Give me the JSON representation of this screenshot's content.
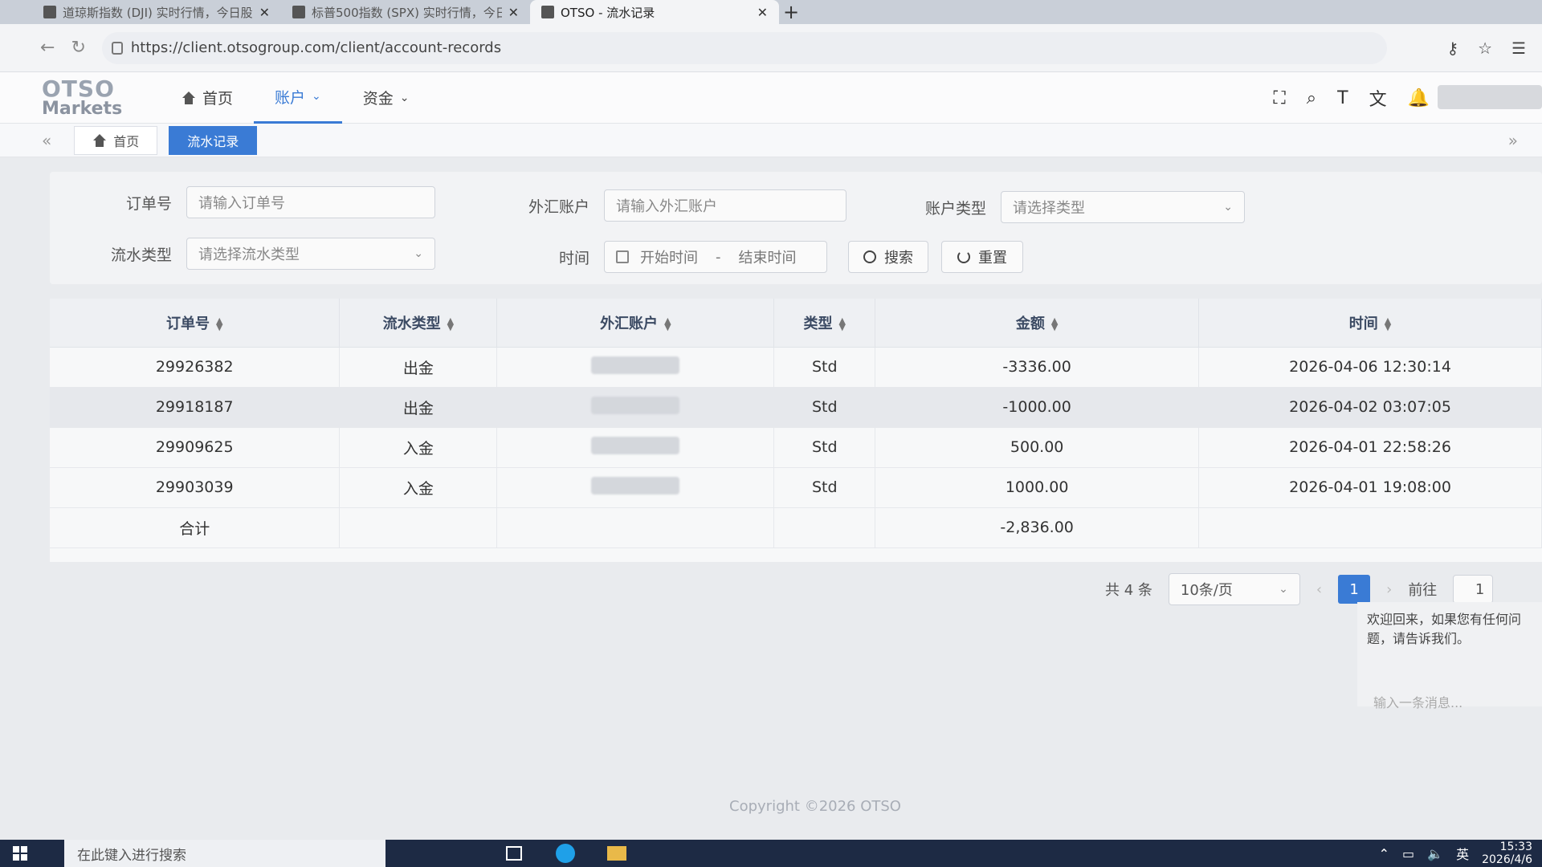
{
  "browser": {
    "tabs": [
      {
        "title": "道琼斯指数 (DJI) 实时行情，今日股",
        "active": false
      },
      {
        "title": "标普500指数 (SPX) 实时行情，今日",
        "active": false
      },
      {
        "title": "OTSO - 流水记录",
        "active": true
      }
    ],
    "new_tab": "+",
    "url": "https://client.otsogroup.com/client/account-records"
  },
  "app": {
    "logo_line1": "OTSO",
    "logo_line2": "Markets",
    "nav": [
      {
        "label": "首页",
        "active": false
      },
      {
        "label": "账户",
        "active": true
      },
      {
        "label": "资金",
        "active": false
      }
    ]
  },
  "tags": [
    {
      "label": "首页",
      "active": false
    },
    {
      "label": "流水记录",
      "active": true
    }
  ],
  "filters": {
    "order_no_label": "订单号",
    "order_no_placeholder": "请输入订单号",
    "fx_account_label": "外汇账户",
    "fx_account_placeholder": "请输入外汇账户",
    "account_type_label": "账户类型",
    "account_type_placeholder": "请选择类型",
    "flow_type_label": "流水类型",
    "flow_type_placeholder": "请选择流水类型",
    "time_label": "时间",
    "start_placeholder": "开始时间",
    "range_sep": "-",
    "end_placeholder": "结束时间",
    "search_button": "搜索",
    "reset_button": "重置"
  },
  "table": {
    "columns": [
      "订单号",
      "流水类型",
      "外汇账户",
      "类型",
      "金额",
      "时间"
    ],
    "rows": [
      {
        "order": "29926382",
        "flow": "出金",
        "account": "",
        "type": "Std",
        "amount": "-3336.00",
        "time": "2026-04-06 12:30:14"
      },
      {
        "order": "29918187",
        "flow": "出金",
        "account": "",
        "type": "Std",
        "amount": "-1000.00",
        "time": "2026-04-02 03:07:05"
      },
      {
        "order": "29909625",
        "flow": "入金",
        "account": "",
        "type": "Std",
        "amount": "500.00",
        "time": "2026-04-01 22:58:26"
      },
      {
        "order": "29903039",
        "flow": "入金",
        "account": "",
        "type": "Std",
        "amount": "1000.00",
        "time": "2026-04-01 19:08:00"
      }
    ],
    "total_label": "合计",
    "total_amount": "-2,836.00"
  },
  "pagination": {
    "total_text": "共 4 条",
    "page_size": "10条/页",
    "current_page": "1",
    "goto_label": "前往",
    "goto_value": "1"
  },
  "chat": {
    "message": "欢迎回来，如果您有任何问题，请告诉我们。",
    "input_placeholder": "输入一条消息..."
  },
  "footer": {
    "copyright": "Copyright ©2026 OTSO"
  },
  "taskbar": {
    "search_placeholder": "在此键入进行搜索",
    "ime": "英",
    "time": "15:33",
    "date": "2026/4/6"
  },
  "colors": {
    "accent": "#3a7bd5",
    "taskbar": "#1d2a44"
  }
}
